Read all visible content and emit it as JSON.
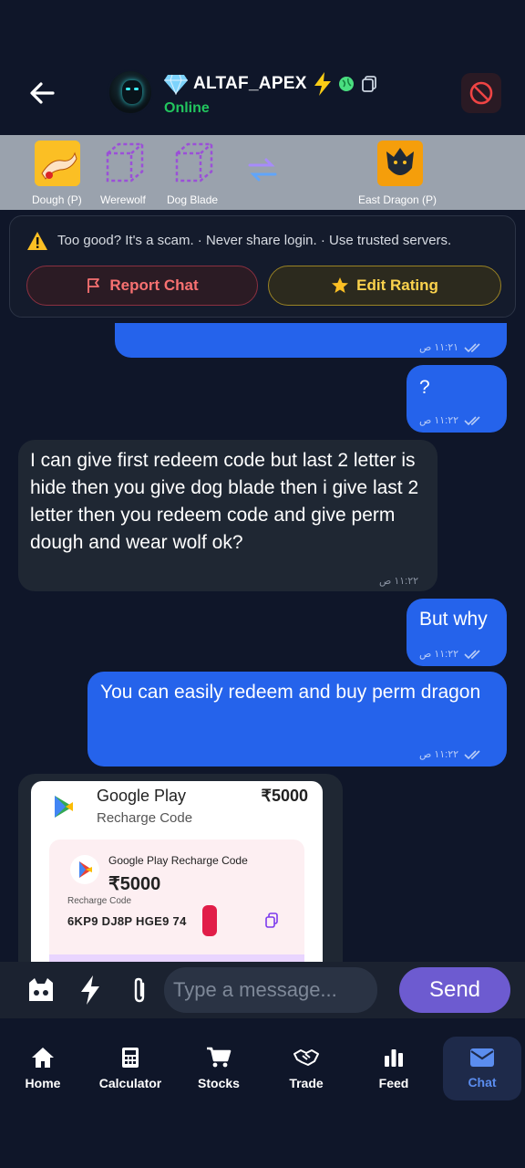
{
  "header": {
    "username": "ALTAF_APEX",
    "status": "Online"
  },
  "trade": {
    "items": [
      {
        "label": "Dough (P)"
      },
      {
        "label": "Werewolf"
      },
      {
        "label": "Dog Blade"
      },
      {
        "label": "East Dragon (P)"
      }
    ]
  },
  "warning": {
    "text": "Too good? It's a scam. · Never share login. · Use trusted servers.",
    "report_label": "Report Chat",
    "rating_label": "Edit Rating"
  },
  "messages": [
    {
      "dir": "out",
      "text": "",
      "time": "١١:٢١ ص"
    },
    {
      "dir": "out",
      "text": "?",
      "time": "١١:٢٢ ص"
    },
    {
      "dir": "in",
      "text": "I can give first redeem code but last 2 letter is hide then you give dog blade then i give last 2 letter then you redeem code and give perm dough and wear wolf ok?",
      "time": "١١:٢٢ ص"
    },
    {
      "dir": "out",
      "text": "But why",
      "time": "١١:٢٢ ص"
    },
    {
      "dir": "out",
      "text": "You can easily redeem and buy perm dragon",
      "time": "١١:٢٢ ص"
    }
  ],
  "image_card": {
    "title": "Google Play",
    "subtitle": "Recharge Code",
    "amount": "₹5000",
    "inner_title": "Google Play Recharge Code",
    "inner_amount": "₹5000",
    "code_label": "Recharge Code",
    "code": "6KP9 DJ8P HGE9 74"
  },
  "input": {
    "placeholder": "Type a message...",
    "send_label": "Send"
  },
  "nav": [
    {
      "label": "Home",
      "icon": "home-icon"
    },
    {
      "label": "Calculator",
      "icon": "calculator-icon"
    },
    {
      "label": "Stocks",
      "icon": "cart-icon"
    },
    {
      "label": "Trade",
      "icon": "handshake-icon"
    },
    {
      "label": "Feed",
      "icon": "bar-chart-icon"
    },
    {
      "label": "Chat",
      "icon": "mail-icon",
      "active": true
    }
  ],
  "colors": {
    "background": "#0f1629",
    "outgoing_bubble": "#2563eb",
    "incoming_bubble": "#1f2733",
    "online": "#22c55e",
    "send_button": "#6d5bd0",
    "active_nav": "#5b8def"
  }
}
